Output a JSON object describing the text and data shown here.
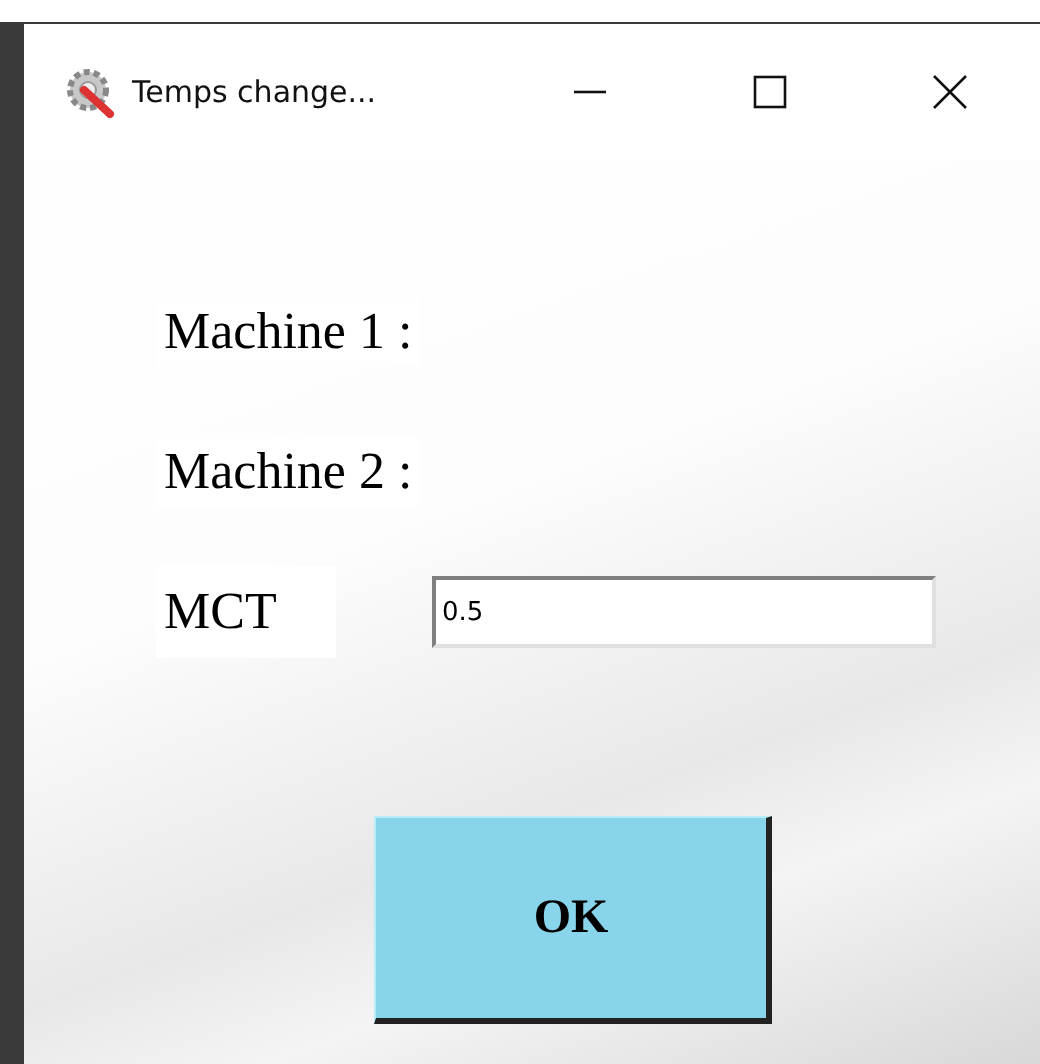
{
  "window": {
    "title": "Temps change..."
  },
  "rows": [
    {
      "kind": "label",
      "label": "Machine 1 :"
    },
    {
      "kind": "label",
      "label": "Machine 2 :"
    },
    {
      "kind": "input",
      "label": "MCT",
      "value": "0.5"
    }
  ],
  "button": "OK"
}
